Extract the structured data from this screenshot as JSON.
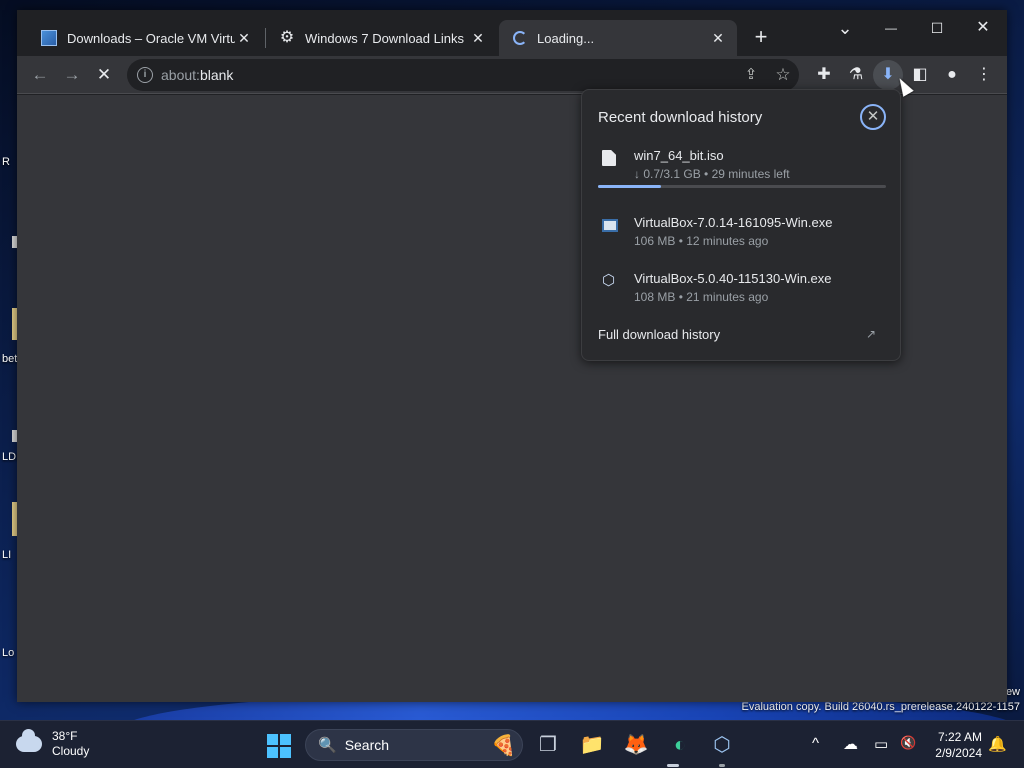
{
  "window": {
    "tabs": [
      {
        "title": "Downloads – Oracle VM VirtualBox",
        "favicon": "virtualbox-icon"
      },
      {
        "title": "Windows 7 Download Links",
        "favicon": "gear-icon"
      },
      {
        "title": "Loading...",
        "favicon": "loading-spinner-icon",
        "active": true
      }
    ],
    "new_tab_glyph": "+",
    "controls": {
      "dropdown": "⌄",
      "minimize": "—",
      "maximize": "☐",
      "close": "✕"
    }
  },
  "toolbar": {
    "back": "←",
    "forward": "→",
    "stop": "✕",
    "url_scheme": "about:",
    "url_host": "blank",
    "share": "⇪",
    "star": "☆",
    "extensions": "✚",
    "labs": "⚗",
    "download": "⬇",
    "side_panel": "◧",
    "profile": "●",
    "menu": "⋮"
  },
  "downloads": {
    "title": "Recent download history",
    "close": "✕",
    "items": [
      {
        "name": "win7_64_bit.iso",
        "meta": "↓ 0.7/3.1 GB • 29 minutes left",
        "icon": "file-icon",
        "progress": 0.22
      },
      {
        "name": "VirtualBox-7.0.14-161095-Win.exe",
        "meta": "106 MB • 12 minutes ago",
        "icon": "exe-icon"
      },
      {
        "name": "VirtualBox-5.0.40-115130-Win.exe",
        "meta": "108 MB • 21 minutes ago",
        "icon": "virtualbox-cube-icon"
      }
    ],
    "full_history": "Full download history",
    "open_external": "↗"
  },
  "desktop": {
    "icon_labels": [
      "R",
      "bet",
      "LDI",
      "LI",
      "Lo"
    ],
    "watermark": "Evaluation copy. Build 26040.rs_prerelease.240122-1157",
    "watermark_top": "ew"
  },
  "taskbar": {
    "weather_temp": "38°F",
    "weather_desc": "Cloudy",
    "search_label": "Search",
    "search_icon": "🔍",
    "search_promo": "🍕",
    "apps": [
      {
        "name": "task-view",
        "glyph": "❐"
      },
      {
        "name": "file-explorer",
        "glyph": "📁"
      },
      {
        "name": "firefox",
        "glyph": "🦊"
      },
      {
        "name": "edge-chrome",
        "glyph": "◐"
      },
      {
        "name": "virtualbox",
        "glyph": "⬡"
      }
    ],
    "tray": {
      "chevron": "^",
      "onedrive": "☁",
      "display": "▭",
      "volume": "🔇",
      "bell": "🔔"
    },
    "time": "7:22 AM",
    "date": "2/9/2024"
  }
}
